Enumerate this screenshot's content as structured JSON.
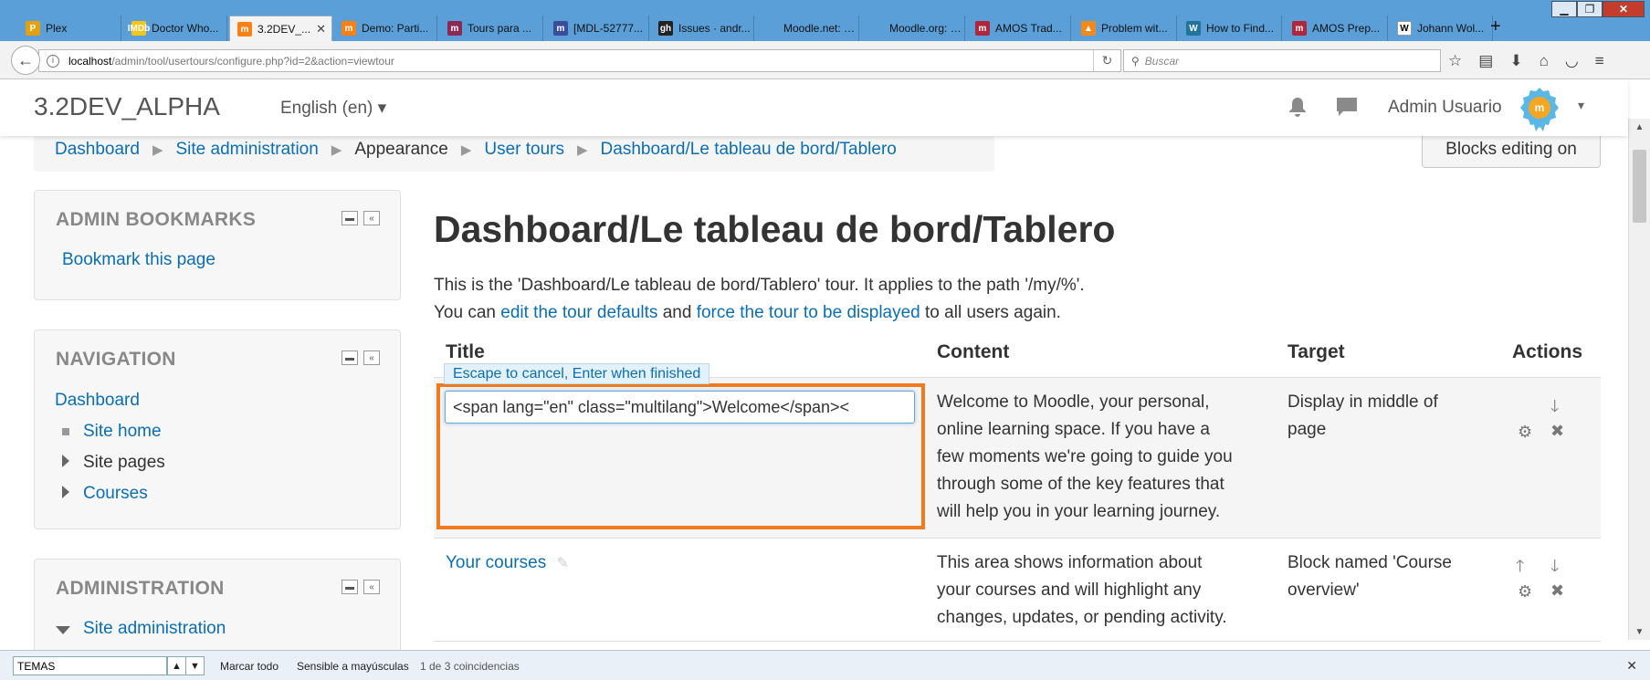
{
  "browser": {
    "tabs": [
      {
        "label": "Plex",
        "fav": "P",
        "color": "#e5a00d",
        "active": false
      },
      {
        "label": "Doctor Who...",
        "fav": "IMDb",
        "color": "#f5c518",
        "active": false
      },
      {
        "label": "3.2DEV_...",
        "fav": "m",
        "color": "#f98012",
        "active": true
      },
      {
        "label": "Demo: Parti...",
        "fav": "m",
        "color": "#f98012",
        "active": false
      },
      {
        "label": "Tours para ...",
        "fav": "m",
        "color": "#8a2a55",
        "active": false
      },
      {
        "label": "[MDL-52777...",
        "fav": "m",
        "color": "#3a4d9a",
        "active": false
      },
      {
        "label": "Issues · andr...",
        "fav": "gh",
        "color": "#222222",
        "active": false
      },
      {
        "label": "Moodle.net: Use...",
        "fav": "",
        "color": "",
        "active": false
      },
      {
        "label": "Moodle.org: Mo...",
        "fav": "",
        "color": "",
        "active": false
      },
      {
        "label": "AMOS Trad...",
        "fav": "m",
        "color": "#b0263b",
        "active": false
      },
      {
        "label": "Problem wit...",
        "fav": "▲",
        "color": "#f08a1e",
        "active": false
      },
      {
        "label": "How to Find...",
        "fav": "W",
        "color": "#21759b",
        "active": false
      },
      {
        "label": "AMOS Prep...",
        "fav": "m",
        "color": "#b0263b",
        "active": false
      },
      {
        "label": "Johann Wol...",
        "fav": "W",
        "color": "#ffffff",
        "active": false
      }
    ],
    "new_tab": "+",
    "window": {
      "min": "▁",
      "max": "❐",
      "close": "✕"
    },
    "url_host": "localhost",
    "url_path": "/admin/tool/usertours/configure.php?id=2&action=viewtour",
    "search_placeholder": "Buscar"
  },
  "header": {
    "site_name": "3.2DEV_ALPHA",
    "language": "English (en) ▾",
    "user_name": "Admin Usuario",
    "user_menu": "▾"
  },
  "breadcrumb": {
    "items": [
      "Dashboard",
      "Site administration",
      "Appearance",
      "User tours",
      "Dashboard/Le tableau de bord/Tablero"
    ],
    "separator": "▶"
  },
  "editing_button": "Blocks editing on",
  "blocks": {
    "bookmarks": {
      "title": "ADMIN BOOKMARKS",
      "link": "Bookmark this page"
    },
    "navigation": {
      "title": "NAVIGATION",
      "dashboard": "Dashboard",
      "site_home": "Site home",
      "site_pages": "Site pages",
      "courses": "Courses"
    },
    "administration": {
      "title": "ADMINISTRATION",
      "site_admin": "Site administration"
    }
  },
  "page": {
    "title": "Dashboard/Le tableau de bord/Tablero",
    "desc1": "This is the 'Dashboard/Le tableau de bord/Tablero' tour. It applies to the path '/my/%'.",
    "desc2_pre": "You can ",
    "desc2_link1": "edit the tour defaults",
    "desc2_mid": " and ",
    "desc2_link2": "force the tour to be displayed",
    "desc2_post": " to all users again."
  },
  "table": {
    "headers": {
      "title": "Title",
      "content": "Content",
      "target": "Target",
      "actions": "Actions"
    },
    "edit_hint": "Escape to cancel, Enter when finished",
    "edit_value": "<span lang=\"en\" class=\"multilang\">Welcome</span><",
    "rows": [
      {
        "content": [
          "Welcome to Moodle, your personal,",
          "online learning space. If you have a",
          "few moments we're going to guide you",
          "through some of the key features that",
          "will help you in your learning journey."
        ],
        "target": [
          "Display in middle of",
          "page"
        ]
      },
      {
        "title": "Your courses",
        "content": [
          "This area shows information about",
          "your courses and will highlight any",
          "changes, updates, or pending activity."
        ],
        "target": [
          "Block named 'Course",
          "overview'"
        ]
      }
    ]
  },
  "findbar": {
    "value": "TEMAS",
    "highlight_all": "Marcar todo",
    "match_case": "Sensible a mayúsculas",
    "status": "1 de 3 coincidencias"
  },
  "colors": {
    "link": "#0a6eb4",
    "highlight": "#f07a1e",
    "tabstrip": "#5a9fd8"
  }
}
